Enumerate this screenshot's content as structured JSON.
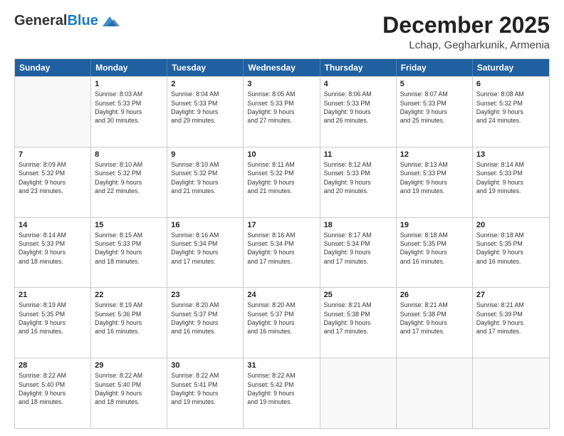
{
  "header": {
    "logo_general": "General",
    "logo_blue": "Blue",
    "month": "December 2025",
    "location": "Lchap, Gegharkunik, Armenia"
  },
  "weekdays": [
    "Sunday",
    "Monday",
    "Tuesday",
    "Wednesday",
    "Thursday",
    "Friday",
    "Saturday"
  ],
  "rows": [
    [
      {
        "day": "",
        "info": ""
      },
      {
        "day": "1",
        "info": "Sunrise: 8:03 AM\nSunset: 5:33 PM\nDaylight: 9 hours\nand 30 minutes."
      },
      {
        "day": "2",
        "info": "Sunrise: 8:04 AM\nSunset: 5:33 PM\nDaylight: 9 hours\nand 29 minutes."
      },
      {
        "day": "3",
        "info": "Sunrise: 8:05 AM\nSunset: 5:33 PM\nDaylight: 9 hours\nand 27 minutes."
      },
      {
        "day": "4",
        "info": "Sunrise: 8:06 AM\nSunset: 5:33 PM\nDaylight: 9 hours\nand 26 minutes."
      },
      {
        "day": "5",
        "info": "Sunrise: 8:07 AM\nSunset: 5:33 PM\nDaylight: 9 hours\nand 25 minutes."
      },
      {
        "day": "6",
        "info": "Sunrise: 8:08 AM\nSunset: 5:32 PM\nDaylight: 9 hours\nand 24 minutes."
      }
    ],
    [
      {
        "day": "7",
        "info": "Sunrise: 8:09 AM\nSunset: 5:32 PM\nDaylight: 9 hours\nand 23 minutes."
      },
      {
        "day": "8",
        "info": "Sunrise: 8:10 AM\nSunset: 5:32 PM\nDaylight: 9 hours\nand 22 minutes."
      },
      {
        "day": "9",
        "info": "Sunrise: 8:10 AM\nSunset: 5:32 PM\nDaylight: 9 hours\nand 21 minutes."
      },
      {
        "day": "10",
        "info": "Sunrise: 8:11 AM\nSunset: 5:32 PM\nDaylight: 9 hours\nand 21 minutes."
      },
      {
        "day": "11",
        "info": "Sunrise: 8:12 AM\nSunset: 5:33 PM\nDaylight: 9 hours\nand 20 minutes."
      },
      {
        "day": "12",
        "info": "Sunrise: 8:13 AM\nSunset: 5:33 PM\nDaylight: 9 hours\nand 19 minutes."
      },
      {
        "day": "13",
        "info": "Sunrise: 8:14 AM\nSunset: 5:33 PM\nDaylight: 9 hours\nand 19 minutes."
      }
    ],
    [
      {
        "day": "14",
        "info": "Sunrise: 8:14 AM\nSunset: 5:33 PM\nDaylight: 9 hours\nand 18 minutes."
      },
      {
        "day": "15",
        "info": "Sunrise: 8:15 AM\nSunset: 5:33 PM\nDaylight: 9 hours\nand 18 minutes."
      },
      {
        "day": "16",
        "info": "Sunrise: 8:16 AM\nSunset: 5:34 PM\nDaylight: 9 hours\nand 17 minutes."
      },
      {
        "day": "17",
        "info": "Sunrise: 8:16 AM\nSunset: 5:34 PM\nDaylight: 9 hours\nand 17 minutes."
      },
      {
        "day": "18",
        "info": "Sunrise: 8:17 AM\nSunset: 5:34 PM\nDaylight: 9 hours\nand 17 minutes."
      },
      {
        "day": "19",
        "info": "Sunrise: 8:18 AM\nSunset: 5:35 PM\nDaylight: 9 hours\nand 16 minutes."
      },
      {
        "day": "20",
        "info": "Sunrise: 8:18 AM\nSunset: 5:35 PM\nDaylight: 9 hours\nand 16 minutes."
      }
    ],
    [
      {
        "day": "21",
        "info": "Sunrise: 8:19 AM\nSunset: 5:35 PM\nDaylight: 9 hours\nand 16 minutes."
      },
      {
        "day": "22",
        "info": "Sunrise: 8:19 AM\nSunset: 5:36 PM\nDaylight: 9 hours\nand 16 minutes."
      },
      {
        "day": "23",
        "info": "Sunrise: 8:20 AM\nSunset: 5:37 PM\nDaylight: 9 hours\nand 16 minutes."
      },
      {
        "day": "24",
        "info": "Sunrise: 8:20 AM\nSunset: 5:37 PM\nDaylight: 9 hours\nand 16 minutes."
      },
      {
        "day": "25",
        "info": "Sunrise: 8:21 AM\nSunset: 5:38 PM\nDaylight: 9 hours\nand 17 minutes."
      },
      {
        "day": "26",
        "info": "Sunrise: 8:21 AM\nSunset: 5:38 PM\nDaylight: 9 hours\nand 17 minutes."
      },
      {
        "day": "27",
        "info": "Sunrise: 8:21 AM\nSunset: 5:39 PM\nDaylight: 9 hours\nand 17 minutes."
      }
    ],
    [
      {
        "day": "28",
        "info": "Sunrise: 8:22 AM\nSunset: 5:40 PM\nDaylight: 9 hours\nand 18 minutes."
      },
      {
        "day": "29",
        "info": "Sunrise: 8:22 AM\nSunset: 5:40 PM\nDaylight: 9 hours\nand 18 minutes."
      },
      {
        "day": "30",
        "info": "Sunrise: 8:22 AM\nSunset: 5:41 PM\nDaylight: 9 hours\nand 19 minutes."
      },
      {
        "day": "31",
        "info": "Sunrise: 8:22 AM\nSunset: 5:42 PM\nDaylight: 9 hours\nand 19 minutes."
      },
      {
        "day": "",
        "info": ""
      },
      {
        "day": "",
        "info": ""
      },
      {
        "day": "",
        "info": ""
      }
    ]
  ]
}
